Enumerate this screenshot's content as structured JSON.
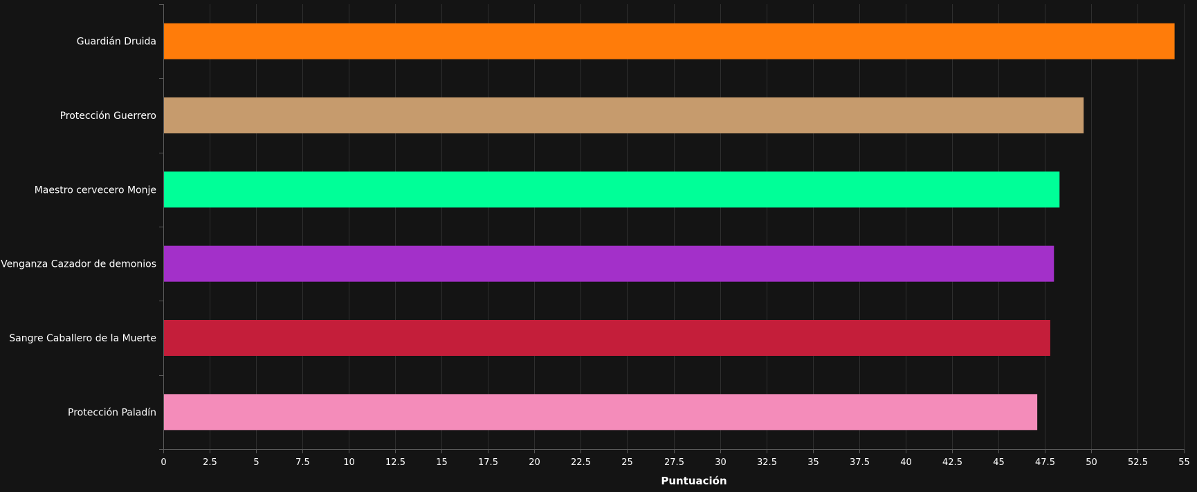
{
  "chart_data": {
    "type": "bar",
    "orientation": "horizontal",
    "xlabel": "Puntuación",
    "ylabel": "",
    "xlim": [
      0,
      55
    ],
    "xtick_step": 2.5,
    "xticks": [
      "0",
      "2.5",
      "5",
      "7.5",
      "10",
      "12.5",
      "15",
      "17.5",
      "20",
      "22.5",
      "25",
      "27.5",
      "30",
      "32.5",
      "35",
      "37.5",
      "40",
      "42.5",
      "45",
      "47.5",
      "50",
      "52.5",
      "55"
    ],
    "grid": "vertical",
    "legend": "none",
    "categories": [
      "Guardián Druida",
      "Protección Guerrero",
      "Maestro cervecero Monje",
      "Venganza Cazador de demonios",
      "Sangre Caballero de la Muerte",
      "Protección Paladín"
    ],
    "values": [
      54.5,
      49.6,
      48.3,
      48.0,
      47.8,
      47.1
    ],
    "colors": [
      "#FF7C0A",
      "#C69B6D",
      "#00FF98",
      "#A330C9",
      "#C41E3A",
      "#F48CBA"
    ],
    "background": "#141414",
    "grid_color": "#2f2f2f",
    "axis_color": "#5a5a5a",
    "text_color": "#ffffff"
  }
}
